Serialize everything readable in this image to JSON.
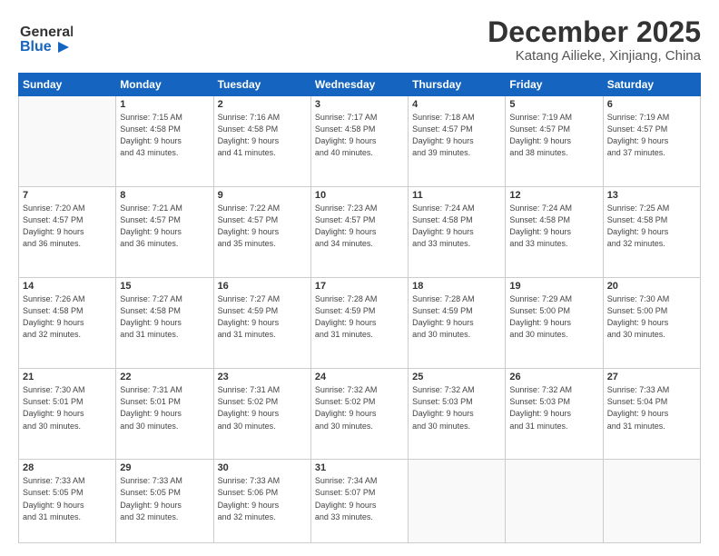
{
  "logo": {
    "line1": "General",
    "line2": "Blue"
  },
  "title": "December 2025",
  "subtitle": "Katang Ailieke, Xinjiang, China",
  "weekdays": [
    "Sunday",
    "Monday",
    "Tuesday",
    "Wednesday",
    "Thursday",
    "Friday",
    "Saturday"
  ],
  "weeks": [
    [
      {
        "day": "",
        "info": ""
      },
      {
        "day": "1",
        "info": "Sunrise: 7:15 AM\nSunset: 4:58 PM\nDaylight: 9 hours\nand 43 minutes."
      },
      {
        "day": "2",
        "info": "Sunrise: 7:16 AM\nSunset: 4:58 PM\nDaylight: 9 hours\nand 41 minutes."
      },
      {
        "day": "3",
        "info": "Sunrise: 7:17 AM\nSunset: 4:58 PM\nDaylight: 9 hours\nand 40 minutes."
      },
      {
        "day": "4",
        "info": "Sunrise: 7:18 AM\nSunset: 4:57 PM\nDaylight: 9 hours\nand 39 minutes."
      },
      {
        "day": "5",
        "info": "Sunrise: 7:19 AM\nSunset: 4:57 PM\nDaylight: 9 hours\nand 38 minutes."
      },
      {
        "day": "6",
        "info": "Sunrise: 7:19 AM\nSunset: 4:57 PM\nDaylight: 9 hours\nand 37 minutes."
      }
    ],
    [
      {
        "day": "7",
        "info": "Sunrise: 7:20 AM\nSunset: 4:57 PM\nDaylight: 9 hours\nand 36 minutes."
      },
      {
        "day": "8",
        "info": "Sunrise: 7:21 AM\nSunset: 4:57 PM\nDaylight: 9 hours\nand 36 minutes."
      },
      {
        "day": "9",
        "info": "Sunrise: 7:22 AM\nSunset: 4:57 PM\nDaylight: 9 hours\nand 35 minutes."
      },
      {
        "day": "10",
        "info": "Sunrise: 7:23 AM\nSunset: 4:57 PM\nDaylight: 9 hours\nand 34 minutes."
      },
      {
        "day": "11",
        "info": "Sunrise: 7:24 AM\nSunset: 4:58 PM\nDaylight: 9 hours\nand 33 minutes."
      },
      {
        "day": "12",
        "info": "Sunrise: 7:24 AM\nSunset: 4:58 PM\nDaylight: 9 hours\nand 33 minutes."
      },
      {
        "day": "13",
        "info": "Sunrise: 7:25 AM\nSunset: 4:58 PM\nDaylight: 9 hours\nand 32 minutes."
      }
    ],
    [
      {
        "day": "14",
        "info": "Sunrise: 7:26 AM\nSunset: 4:58 PM\nDaylight: 9 hours\nand 32 minutes."
      },
      {
        "day": "15",
        "info": "Sunrise: 7:27 AM\nSunset: 4:58 PM\nDaylight: 9 hours\nand 31 minutes."
      },
      {
        "day": "16",
        "info": "Sunrise: 7:27 AM\nSunset: 4:59 PM\nDaylight: 9 hours\nand 31 minutes."
      },
      {
        "day": "17",
        "info": "Sunrise: 7:28 AM\nSunset: 4:59 PM\nDaylight: 9 hours\nand 31 minutes."
      },
      {
        "day": "18",
        "info": "Sunrise: 7:28 AM\nSunset: 4:59 PM\nDaylight: 9 hours\nand 30 minutes."
      },
      {
        "day": "19",
        "info": "Sunrise: 7:29 AM\nSunset: 5:00 PM\nDaylight: 9 hours\nand 30 minutes."
      },
      {
        "day": "20",
        "info": "Sunrise: 7:30 AM\nSunset: 5:00 PM\nDaylight: 9 hours\nand 30 minutes."
      }
    ],
    [
      {
        "day": "21",
        "info": "Sunrise: 7:30 AM\nSunset: 5:01 PM\nDaylight: 9 hours\nand 30 minutes."
      },
      {
        "day": "22",
        "info": "Sunrise: 7:31 AM\nSunset: 5:01 PM\nDaylight: 9 hours\nand 30 minutes."
      },
      {
        "day": "23",
        "info": "Sunrise: 7:31 AM\nSunset: 5:02 PM\nDaylight: 9 hours\nand 30 minutes."
      },
      {
        "day": "24",
        "info": "Sunrise: 7:32 AM\nSunset: 5:02 PM\nDaylight: 9 hours\nand 30 minutes."
      },
      {
        "day": "25",
        "info": "Sunrise: 7:32 AM\nSunset: 5:03 PM\nDaylight: 9 hours\nand 30 minutes."
      },
      {
        "day": "26",
        "info": "Sunrise: 7:32 AM\nSunset: 5:03 PM\nDaylight: 9 hours\nand 31 minutes."
      },
      {
        "day": "27",
        "info": "Sunrise: 7:33 AM\nSunset: 5:04 PM\nDaylight: 9 hours\nand 31 minutes."
      }
    ],
    [
      {
        "day": "28",
        "info": "Sunrise: 7:33 AM\nSunset: 5:05 PM\nDaylight: 9 hours\nand 31 minutes."
      },
      {
        "day": "29",
        "info": "Sunrise: 7:33 AM\nSunset: 5:05 PM\nDaylight: 9 hours\nand 32 minutes."
      },
      {
        "day": "30",
        "info": "Sunrise: 7:33 AM\nSunset: 5:06 PM\nDaylight: 9 hours\nand 32 minutes."
      },
      {
        "day": "31",
        "info": "Sunrise: 7:34 AM\nSunset: 5:07 PM\nDaylight: 9 hours\nand 33 minutes."
      },
      {
        "day": "",
        "info": ""
      },
      {
        "day": "",
        "info": ""
      },
      {
        "day": "",
        "info": ""
      }
    ]
  ]
}
